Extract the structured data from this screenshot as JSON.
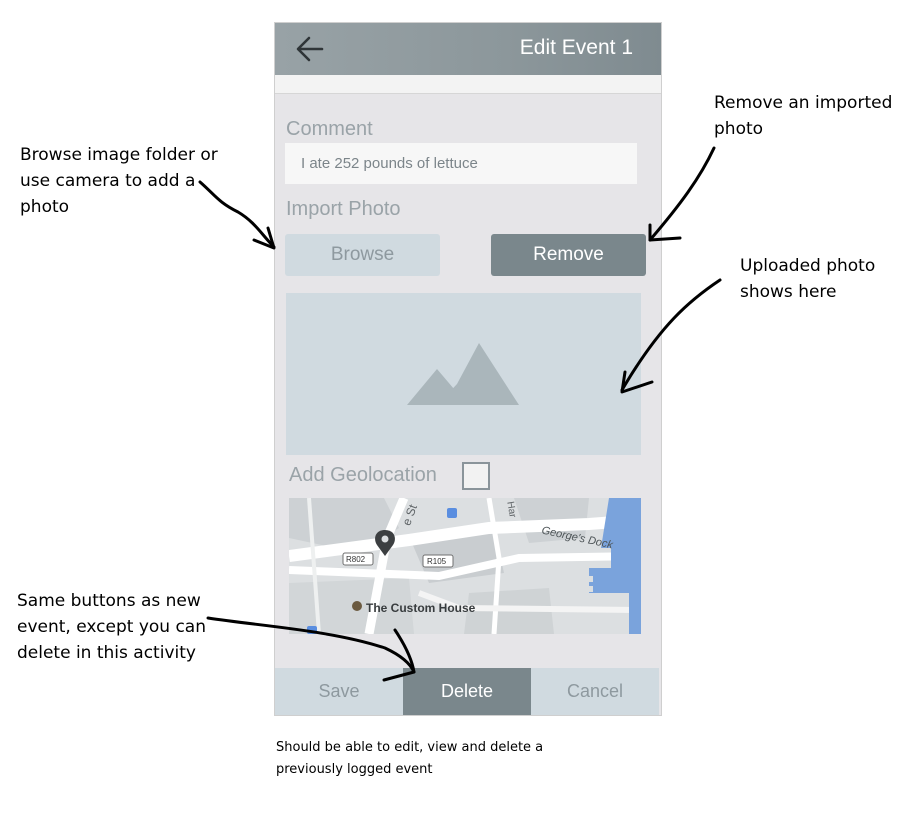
{
  "annotations": {
    "browse_note": [
      "Browse image folder or",
      "use camera to add a",
      "photo"
    ],
    "remove_note": [
      "Remove an imported",
      "photo"
    ],
    "upload_note": [
      "Uploaded photo",
      "shows here"
    ],
    "buttons_note": [
      "Same buttons as new",
      "event, except you can",
      "delete in this activity"
    ],
    "caption": [
      "Should be able to edit, view and delete a",
      "previously logged event"
    ]
  },
  "appbar": {
    "title": "Edit Event 1",
    "back_icon": "arrow-left-icon"
  },
  "form": {
    "comment_label": "Comment",
    "comment_value": "I ate 252 pounds of lettuce",
    "import_label": "Import Photo",
    "browse_label": "Browse",
    "remove_label": "Remove",
    "photo_icon": "image-placeholder-icon",
    "geo_label": "Add Geolocation",
    "geo_checked": false
  },
  "map": {
    "poi": "The Custom House",
    "dock": "George's Dock",
    "street_fragment": "e St",
    "road_a": "R802",
    "road_b": "R105",
    "road_c": "Har"
  },
  "bottombar": {
    "save_label": "Save",
    "delete_label": "Delete",
    "cancel_label": "Cancel"
  },
  "colors": {
    "appbar": "#8c979b",
    "accent_button": "#7a878c",
    "light_button": "#d0dae0",
    "panel": "#e6e5e8"
  }
}
